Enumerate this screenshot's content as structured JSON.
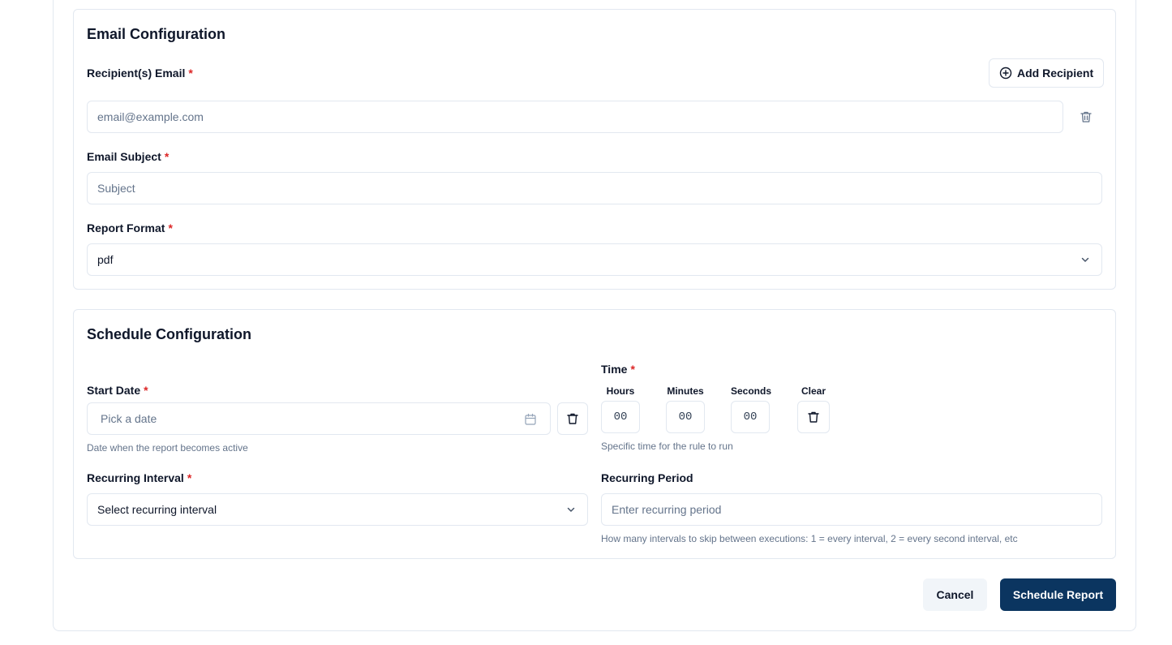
{
  "email_config": {
    "title": "Email Configuration",
    "recipients_label": "Recipient(s) Email",
    "add_recipient_label": "Add Recipient",
    "email_placeholder": "email@example.com",
    "subject_label": "Email Subject",
    "subject_placeholder": "Subject",
    "format_label": "Report Format",
    "format_value": "pdf"
  },
  "schedule_config": {
    "title": "Schedule Configuration",
    "start_date_label": "Start Date",
    "start_date_placeholder": "Pick a date",
    "start_date_help": "Date when the report becomes active",
    "time_label": "Time",
    "hours_label": "Hours",
    "minutes_label": "Minutes",
    "seconds_label": "Seconds",
    "clear_label": "Clear",
    "hours_value": "00",
    "minutes_value": "00",
    "seconds_value": "00",
    "time_help": "Specific time for the rule to run",
    "interval_label": "Recurring Interval",
    "interval_placeholder": "Select recurring interval",
    "period_label": "Recurring Period",
    "period_placeholder": "Enter recurring period",
    "period_help": "How many intervals to skip between executions: 1 = every interval, 2 = every second interval, etc"
  },
  "required_marker": "*",
  "actions": {
    "cancel_label": "Cancel",
    "submit_label": "Schedule Report"
  },
  "colors": {
    "primary": "#0b3560",
    "required": "#dc2626",
    "border": "#e2e8f0",
    "muted_text": "#64748b"
  }
}
